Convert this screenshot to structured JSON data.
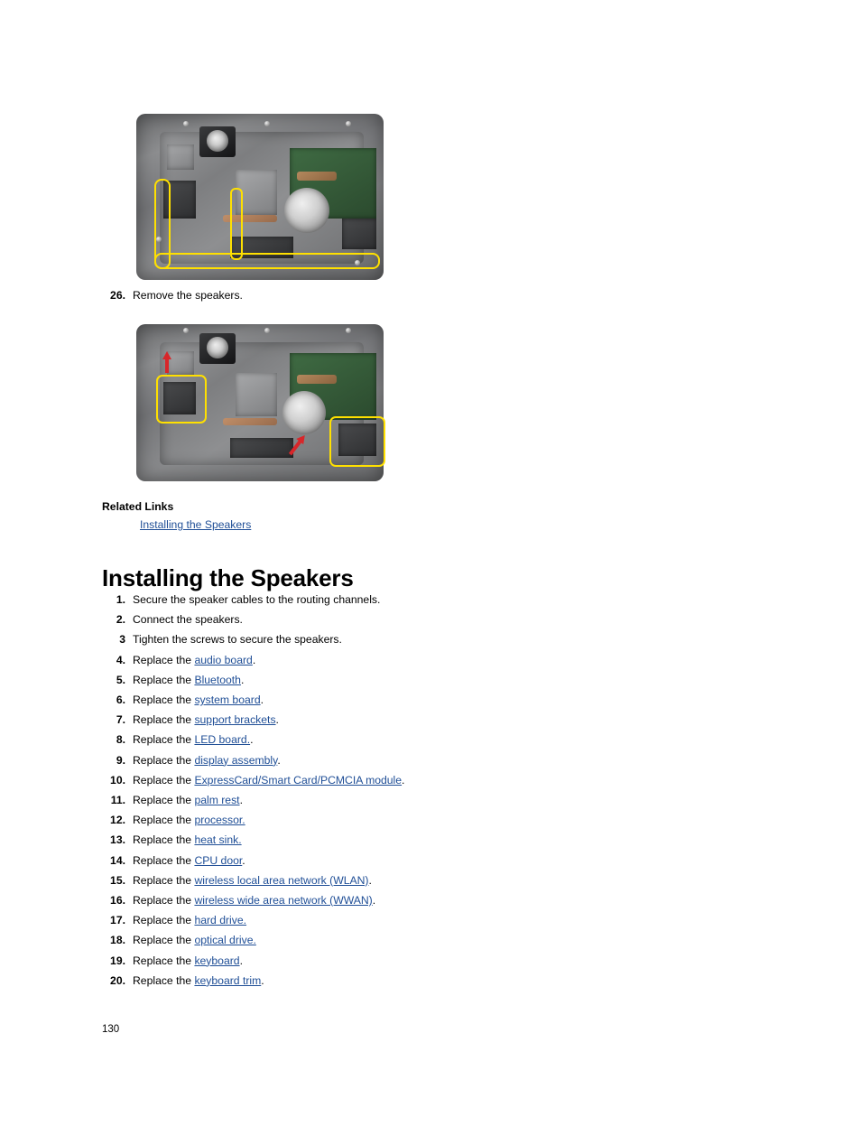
{
  "figures": [
    {
      "name": "speaker-cable-routing-figure",
      "caption": "Laptop base chassis with speaker cables highlighted along the routing channels"
    },
    {
      "name": "speaker-removal-figure",
      "caption": "Laptop base chassis with left and right speakers highlighted and removal arrows"
    }
  ],
  "remove_step": {
    "number": "26.",
    "text": "Remove the speakers."
  },
  "related": {
    "title": "Related Links",
    "links": [
      {
        "label": "Installing the Speakers"
      }
    ]
  },
  "heading": "Installing the Speakers",
  "install_steps": [
    {
      "number": "1.",
      "prefix": "Secure the speaker cables to the routing channels.",
      "link": "",
      "suffix": ""
    },
    {
      "number": "2.",
      "prefix": "Connect the speakers.",
      "link": "",
      "suffix": ""
    },
    {
      "number": "3",
      "prefix": "Tighten the screws to secure the speakers.",
      "link": "",
      "suffix": ""
    },
    {
      "number": "4.",
      "prefix": "Replace the ",
      "link": "audio board",
      "suffix": "."
    },
    {
      "number": "5.",
      "prefix": "Replace the ",
      "link": "Bluetooth",
      "suffix": "."
    },
    {
      "number": "6.",
      "prefix": "Replace the ",
      "link": "system board",
      "suffix": "."
    },
    {
      "number": "7.",
      "prefix": "Replace the ",
      "link": "support brackets",
      "suffix": "."
    },
    {
      "number": "8.",
      "prefix": "Replace the ",
      "link": "LED board.",
      "suffix": "."
    },
    {
      "number": "9.",
      "prefix": "Replace the ",
      "link": "display assembly",
      "suffix": "."
    },
    {
      "number": "10.",
      "prefix": "Replace the ",
      "link": "ExpressCard/Smart Card/PCMCIA module",
      "suffix": "."
    },
    {
      "number": "11.",
      "prefix": "Replace the ",
      "link": "palm rest",
      "suffix": "."
    },
    {
      "number": "12.",
      "prefix": "Replace the ",
      "link": "processor.",
      "suffix": ""
    },
    {
      "number": "13.",
      "prefix": "Replace the ",
      "link": "heat sink.",
      "suffix": ""
    },
    {
      "number": "14.",
      "prefix": "Replace the ",
      "link": "CPU door",
      "suffix": "."
    },
    {
      "number": "15.",
      "prefix": "Replace the ",
      "link": "wireless local area network (WLAN)",
      "suffix": "."
    },
    {
      "number": "16.",
      "prefix": "Replace the ",
      "link": "wireless wide area network (WWAN)",
      "suffix": "."
    },
    {
      "number": "17.",
      "prefix": "Replace the ",
      "link": "hard drive.",
      "suffix": ""
    },
    {
      "number": "18.",
      "prefix": "Replace the ",
      "link": "optical drive.",
      "suffix": ""
    },
    {
      "number": "19.",
      "prefix": "Replace the ",
      "link": "keyboard",
      "suffix": "."
    },
    {
      "number": "20.",
      "prefix": "Replace the ",
      "link": "keyboard trim",
      "suffix": "."
    }
  ],
  "page_number": "130",
  "colors": {
    "link": "#1f4e96",
    "highlight": "#ffe000",
    "arrow": "#d8262a"
  }
}
